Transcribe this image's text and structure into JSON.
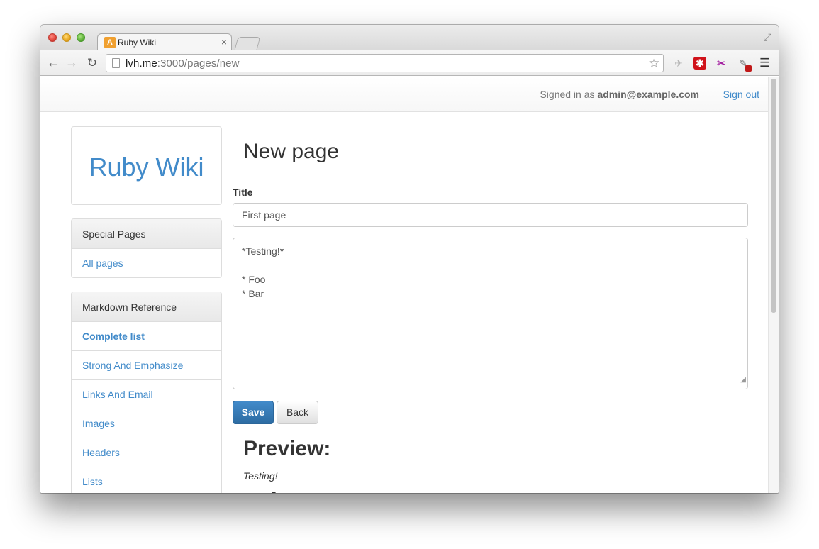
{
  "browser": {
    "tab_title": "Ruby Wiki",
    "tab_favicon": "A",
    "tab_close": "×",
    "url_host": "lvh.me",
    "url_rest": ":3000/pages/new"
  },
  "navbar": {
    "signed_prefix": "Signed in as ",
    "user_email": "admin@example.com",
    "sign_out": "Sign out"
  },
  "sidebar": {
    "brand": "Ruby Wiki",
    "special_pages": {
      "heading": "Special Pages",
      "items": [
        "All pages"
      ]
    },
    "markdown_reference": {
      "heading": "Markdown Reference",
      "items": [
        "Complete list",
        "Strong And Emphasize",
        "Links And Email",
        "Images",
        "Headers",
        "Lists"
      ]
    }
  },
  "main": {
    "heading": "New page",
    "title_label": "Title",
    "title_value": "First page",
    "body_value": "*Testing!*\n\n* Foo\n* Bar",
    "save_label": "Save",
    "back_label": "Back",
    "preview_heading": "Preview:",
    "preview_text": "Testing!"
  },
  "colors": {
    "link": "#428bca",
    "primary_button": "#428bca"
  },
  "icons": [
    "back-arrow-icon",
    "forward-arrow-icon",
    "reload-icon",
    "page-icon",
    "bookmark-star-icon",
    "chrome-menu-icon",
    "fullscreen-icon"
  ]
}
